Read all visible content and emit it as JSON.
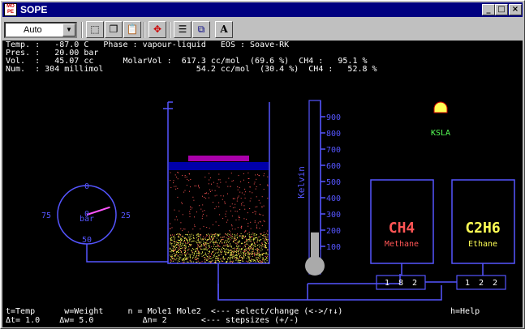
{
  "window": {
    "title": "SOPE",
    "icon_text": "MO PE",
    "minimize": "_",
    "maximize": "□",
    "close": "×"
  },
  "toolbar": {
    "zoom_value": "Auto",
    "zoom_arrow": "▼",
    "buttons": [
      {
        "name": "select-icon",
        "glyph": "⬚"
      },
      {
        "name": "copy-icon",
        "glyph": "❐"
      },
      {
        "name": "paste-icon",
        "glyph": "📋"
      },
      {
        "name": "fullscreen-icon",
        "glyph": "✥"
      },
      {
        "name": "properties-icon",
        "glyph": "☰"
      },
      {
        "name": "background-icon",
        "glyph": "⧉"
      },
      {
        "name": "font-icon",
        "glyph": "A"
      }
    ]
  },
  "status": {
    "line1": "Temp. :   -87.0 C   Phase : vapour-liquid   EOS : Soave-RK",
    "line2": "Pres. :   20.00 bar",
    "line3": "Vol.  :   45.07 cc      MolarVol :  617.3 cc/mol  (69.6 %)  CH4 :   95.1 %",
    "line4": "Num.  : 304 millimol                   54.2 cc/mol  (30.4 %)  CH4 :   52.8 %"
  },
  "gauge": {
    "top": "0",
    "left": "75",
    "right": "25",
    "bottom": "50",
    "center": "0",
    "unit": "bar",
    "reading_bar": 20.0
  },
  "thermometer": {
    "label": "Kelvin",
    "ticks": [
      "900",
      "800",
      "700",
      "600",
      "500",
      "400",
      "300",
      "200",
      "100"
    ],
    "fill_kelvin": 186
  },
  "logo": {
    "text": "KSLA"
  },
  "components": [
    {
      "formula": "CH4",
      "name": "Methane",
      "digits": [
        "1",
        "8",
        "2"
      ],
      "color": "#ff5555"
    },
    {
      "formula": "C2H6",
      "name": "Ethane",
      "digits": [
        "1",
        "2",
        "2"
      ],
      "color": "#ffff55"
    }
  ],
  "help": {
    "line1": "t=Temp      w=Weight     n = Mole1 Mole2  <--- select/change (<->/↑↓)",
    "line1_right": "h=Help",
    "line2": "Δt= 1.0    Δw= 5.0          Δn= 2       <--- stepsizes (+/-)"
  },
  "colors": {
    "structure": "#5555ff",
    "piston_bar": "#0000aa",
    "weight": "#aa00aa",
    "vapour_dot": "#ff5555",
    "liquid_dot": "#ffff55",
    "mercury": "#aaaaaa"
  }
}
